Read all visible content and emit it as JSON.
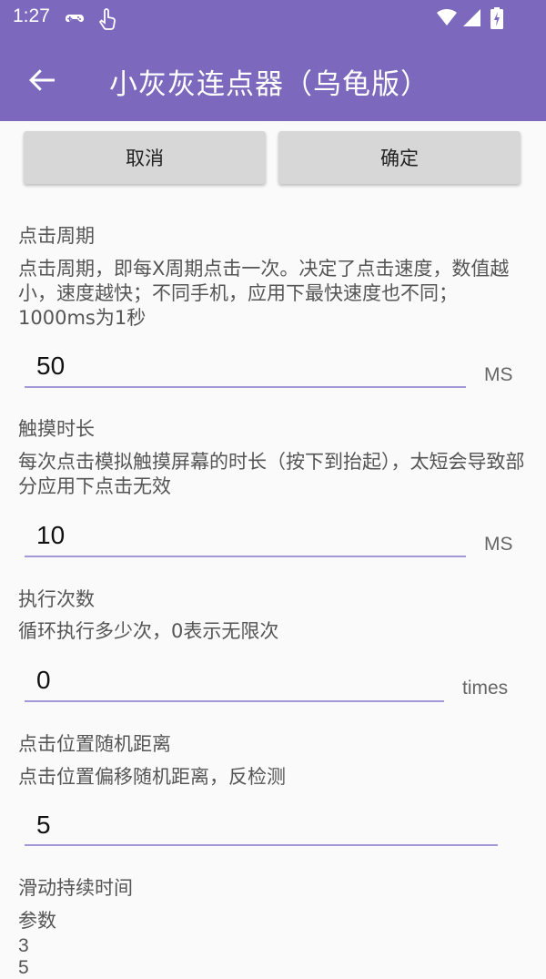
{
  "status": {
    "time": "1:27"
  },
  "appbar": {
    "title": "小灰灰连点器（乌龟版）"
  },
  "buttons": {
    "cancel": "取消",
    "confirm": "确定"
  },
  "settings": [
    {
      "title": "点击周期",
      "description": "点击周期，即每X周期点击一次。决定了点击速度，数值越小，速度越快；不同手机，应用下最快速度也不同；1000ms为1秒",
      "value": "50",
      "unit": "MS"
    },
    {
      "title": "触摸时长",
      "description": "每次点击模拟触摸屏幕的时长（按下到抬起），太短会导致部分应用下点击无效",
      "value": "10",
      "unit": "MS"
    },
    {
      "title": "执行次数",
      "description": "循环执行多少次，0表示无限次",
      "value": "0",
      "unit": "times"
    },
    {
      "title": "点击位置随机距离",
      "description": "点击位置偏移随机距离，反检测",
      "value": "5",
      "unit": ""
    },
    {
      "title": "滑动持续时间",
      "description": "参数",
      "params": [
        "3",
        "5"
      ]
    }
  ]
}
